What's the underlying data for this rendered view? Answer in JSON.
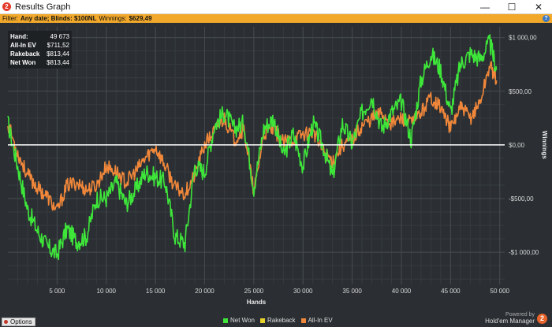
{
  "window": {
    "title": "Results Graph",
    "app_icon_glyph": "2",
    "controls": {
      "minimize": "—",
      "maximize": "☐",
      "close": "✕"
    }
  },
  "filter": {
    "label": "Filter:",
    "value": "Any date; Blinds: $100NL",
    "winnings_label": "Winnings:",
    "winnings_value": "$629,49",
    "help_glyph": "?"
  },
  "info": {
    "rows": [
      {
        "key": "Hand:",
        "value": "49 673"
      },
      {
        "key": "All-In EV",
        "value": "$711,52"
      },
      {
        "key": "Rakeback",
        "value": "$813,44"
      },
      {
        "key": "Net Won",
        "value": "$813,44"
      }
    ]
  },
  "options_label": "Options",
  "brand": {
    "line1": "Powered by",
    "line2": "Hold'em Manager",
    "badge": "2"
  },
  "chart_data": {
    "type": "line",
    "xlabel": "Hands",
    "ylabel": "Winnings",
    "x_ticks": [
      5000,
      10000,
      15000,
      20000,
      25000,
      30000,
      35000,
      40000,
      45000,
      50000
    ],
    "x_tick_labels": [
      "5 000",
      "10 000",
      "15 000",
      "20 000",
      "25 000",
      "30 000",
      "35 000",
      "40 000",
      "45 000",
      "50 000"
    ],
    "y_ticks": [
      1000,
      500,
      0,
      -500,
      -1000
    ],
    "y_tick_labels": [
      "$1 000,00",
      "$500,00",
      "$0,00",
      "-$500,00",
      "-$1 000,00"
    ],
    "xlim": [
      0,
      50500
    ],
    "ylim": [
      -1300,
      1100
    ],
    "grid": true,
    "legend_position": "bottom-center",
    "zero_line_color": "#ffffff",
    "x": [
      0,
      1000,
      2000,
      3000,
      4000,
      5000,
      6000,
      7000,
      8000,
      9000,
      10000,
      11000,
      12000,
      13000,
      14000,
      15000,
      16000,
      17000,
      18000,
      19000,
      20000,
      21000,
      22000,
      23000,
      24000,
      25000,
      26000,
      27000,
      28000,
      29000,
      30000,
      31000,
      32000,
      33000,
      34000,
      35000,
      36000,
      37000,
      38000,
      39000,
      40000,
      41000,
      42000,
      43000,
      44000,
      45000,
      46000,
      47000,
      48000,
      49000,
      49673
    ],
    "series": [
      {
        "name": "Net Won",
        "color": "#3ee63a",
        "values": [
          200,
          -200,
          -600,
          -800,
          -950,
          -1020,
          -780,
          -900,
          -850,
          -500,
          -500,
          -350,
          -550,
          -420,
          -250,
          -300,
          -350,
          -850,
          -920,
          -200,
          -250,
          180,
          300,
          150,
          200,
          -400,
          150,
          250,
          -100,
          100,
          -200,
          200,
          0,
          -300,
          200,
          10,
          300,
          450,
          150,
          300,
          400,
          50,
          600,
          850,
          700,
          300,
          750,
          850,
          800,
          950,
          700
        ]
      },
      {
        "name": "Rakeback",
        "color": "#e8d12a",
        "values": []
      },
      {
        "name": "All-In EV",
        "color": "#f0873a",
        "values": [
          200,
          -80,
          -280,
          -400,
          -480,
          -620,
          -380,
          -350,
          -420,
          -380,
          -200,
          -250,
          -350,
          -250,
          -120,
          -20,
          -200,
          -400,
          -450,
          -280,
          0,
          130,
          250,
          50,
          150,
          -450,
          100,
          150,
          20,
          50,
          100,
          120,
          -50,
          -150,
          0,
          50,
          180,
          250,
          300,
          200,
          250,
          200,
          300,
          450,
          350,
          150,
          350,
          250,
          400,
          750,
          600
        ]
      }
    ]
  }
}
